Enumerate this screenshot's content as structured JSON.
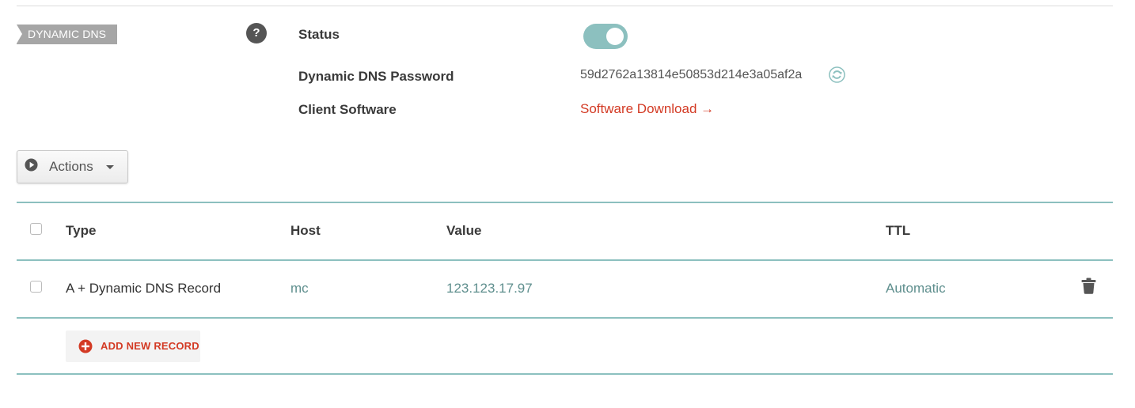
{
  "section": {
    "tag": "DYNAMIC DNS",
    "help_icon": "question-mark-icon"
  },
  "fields": {
    "status_label": "Status",
    "status_enabled": true,
    "password_label": "Dynamic DNS Password",
    "password_value": "59d2762a13814e50853d214e3a05af2a",
    "client_label": "Client Software",
    "client_link": "Software Download →"
  },
  "actions": {
    "label": "Actions",
    "icon": "play-circle-icon"
  },
  "table": {
    "columns": [
      "Type",
      "Host",
      "Value",
      "TTL"
    ],
    "rows": [
      {
        "type": "A + Dynamic DNS Record",
        "host": "mc",
        "value": "123.123.17.97",
        "ttl": "Automatic"
      }
    ],
    "add_label": "ADD NEW RECORD"
  },
  "colors": {
    "accent": "#8cc0bf",
    "link": "#d33a24",
    "tag": "#a6a6a6"
  }
}
